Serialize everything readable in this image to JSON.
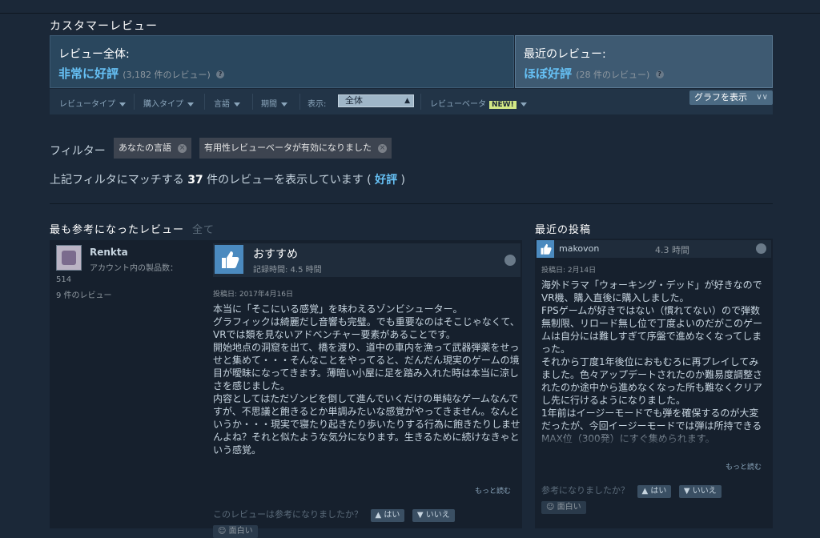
{
  "section": {
    "title": "カスタマーレビュー"
  },
  "summary_all": {
    "label": "レビュー全体:",
    "rating": "非常に好評",
    "count": "(3,182 件のレビュー)"
  },
  "summary_recent": {
    "label": "最近のレビュー:",
    "rating": "ほぼ好評",
    "count": "(28 件のレビュー)"
  },
  "filters": {
    "review_type": "レビュータイプ",
    "purchase_type": "購入タイプ",
    "language": "言語",
    "period": "期間",
    "display_label": "表示:",
    "display_value": "全体",
    "beta": "レビューベータ",
    "beta_badge": "NEW!",
    "graph_button": "グラフを表示"
  },
  "active_filters": {
    "label": "フィルター",
    "chips": [
      "あなたの言語",
      "有用性レビューベータが有効になりました"
    ]
  },
  "match": {
    "prefix": "上記フィルタにマッチする",
    "count": "37",
    "suffix": "件のレビューを表示しています (",
    "rating": "好評",
    "close": ")"
  },
  "helpful_reviews": {
    "heading": "最も参考になったレビュー",
    "heading_all": "全て",
    "author": {
      "name": "Renkta",
      "products_label": "アカウント内の製品数：",
      "products_count": "514",
      "reviews": "9 件のレビュー"
    },
    "verdict": "おすすめ",
    "hours": "記録時間: 4.5 時間",
    "posted": "投稿日: 2017年4月16日",
    "text": [
      "本当に「そこにいる感覚」を味わえるゾンビシューター。",
      "グラフィックは綺麗だし音響も完璧。でも重要なのはそこじゃなくて、VRでは類を見ないアドベンチャー要素があることです。",
      "開始地点の洞窟を出て、橋を渡り、道中の車内を漁って武器弾薬をせっせと集めて・・・そんなことをやってると、だんだん現実のゲームの境目が曖昧になってきます。薄暗い小屋に足を踏み入れた時は本当に涼しさを感じました。",
      "内容としてはただゾンビを倒して進んでいくだけの単純なゲームなんですが、不思議と飽きるとか単調みたいな感覚がやってきません。なんというか・・・現実で寝たり起きたり歩いたりする行為に飽きたりしませんよね？それと似たような気分になります。生きるために続けなきゃという感覚。"
    ],
    "read_more": "もっと読む",
    "helpful_q": "このレビューは参考になりましたか？",
    "yes": "はい",
    "no": "いいえ",
    "funny": "面白い"
  },
  "recent_posts": {
    "heading": "最近の投稿",
    "author": "makovon",
    "hours": "4.3 時間",
    "posted": "投稿日: 2月14日",
    "text": [
      "海外ドラマ「ウォーキング・デッド」が好きなのでVR機、購入直後に購入しました。",
      "FPSゲームが好きではない（慣れてない）ので弾数無制限、リロード無し位で丁度よいのだがこのゲームは自分には難しすぎて序盤で進めなくなってしまった。",
      "それから丁度1年後位におもむろに再プレイしてみました。色々アップデートされたのか難易度調整されたのか途中から進めなくなった所も難なくクリアし先に行けるようになりました。",
      "1年前はイージーモードでも弾を確保するのが大変だったが、今回イージーモードでは弾は所持できるMAX位（300発）にすぐ集められます。"
    ],
    "read_more": "もっと読む",
    "helpful_q": "参考になりましたか？",
    "yes": "はい",
    "no": "いいえ",
    "funny": "面白い"
  },
  "colors": {
    "background": "#1b2838",
    "accent": "#66c0f4",
    "positive": "#66c0f4",
    "new_badge": "#d2e885"
  },
  "icons": [
    "question-icon",
    "caret-down-icon",
    "double-chevron-down-icon",
    "close-circle-icon",
    "thumbs-up-icon",
    "thumbs-down-icon",
    "smiley-icon",
    "steam-icon"
  ]
}
